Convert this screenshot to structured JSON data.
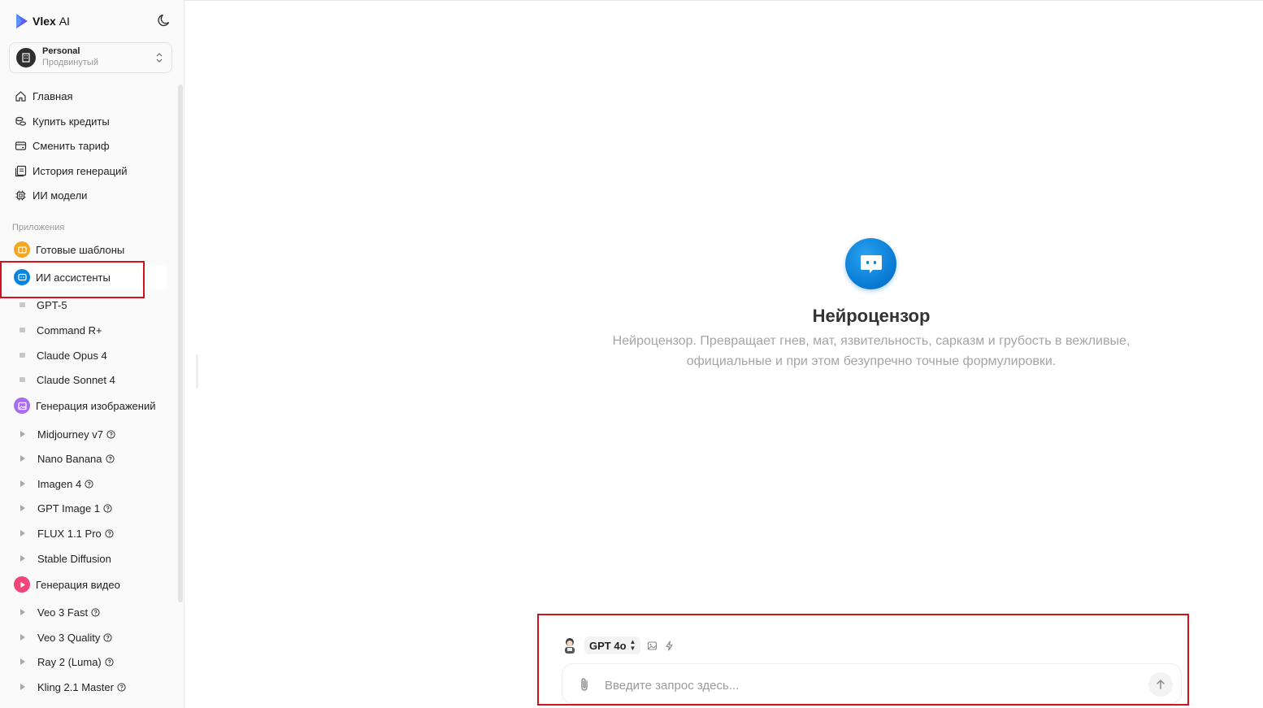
{
  "app": {
    "name": "Vlex",
    "name_suffix": "AI"
  },
  "account": {
    "name": "Personal",
    "plan": "Продвинутый"
  },
  "nav": [
    {
      "label": "Главная",
      "icon": "home-icon"
    },
    {
      "label": "Купить кредиты",
      "icon": "coins-icon"
    },
    {
      "label": "Сменить тариф",
      "icon": "card-icon"
    },
    {
      "label": "История генераций",
      "icon": "history-icon"
    },
    {
      "label": "ИИ модели",
      "icon": "chip-icon"
    }
  ],
  "apps_section_label": "Приложения",
  "apps": {
    "templates": {
      "label": "Готовые шаблоны",
      "color": "#f5a623"
    },
    "assistants": {
      "label": "ИИ ассистенты",
      "color": "#0b84de"
    },
    "images": {
      "label": "Генерация изображений",
      "color": "#a86cf0"
    },
    "video": {
      "label": "Генерация видео",
      "color": "#f0457a"
    }
  },
  "assistants_items": [
    "GPT-5",
    "Command R+",
    "Claude Opus 4",
    "Claude Sonnet 4"
  ],
  "image_items": [
    "Midjourney v7",
    "Nano Banana",
    "Imagen 4",
    "GPT Image 1",
    "FLUX 1.1 Pro",
    "Stable Diffusion"
  ],
  "video_items": [
    "Veo 3 Fast",
    "Veo 3 Quality",
    "Ray 2 (Luma)",
    "Kling 2.1 Master"
  ],
  "assistant": {
    "title": "Нейроцензор",
    "description_line1": "Нейроцензор. Превращает гнев, мат, язвительность, сарказм и грубость в вежливые,",
    "description_line2": "официальные и при этом безупречно точные формулировки."
  },
  "composer": {
    "model": "GPT 4o",
    "placeholder": "Введите запрос здесь..."
  },
  "colors": {
    "highlight": "#d0131f",
    "accent": "#0b84de"
  }
}
